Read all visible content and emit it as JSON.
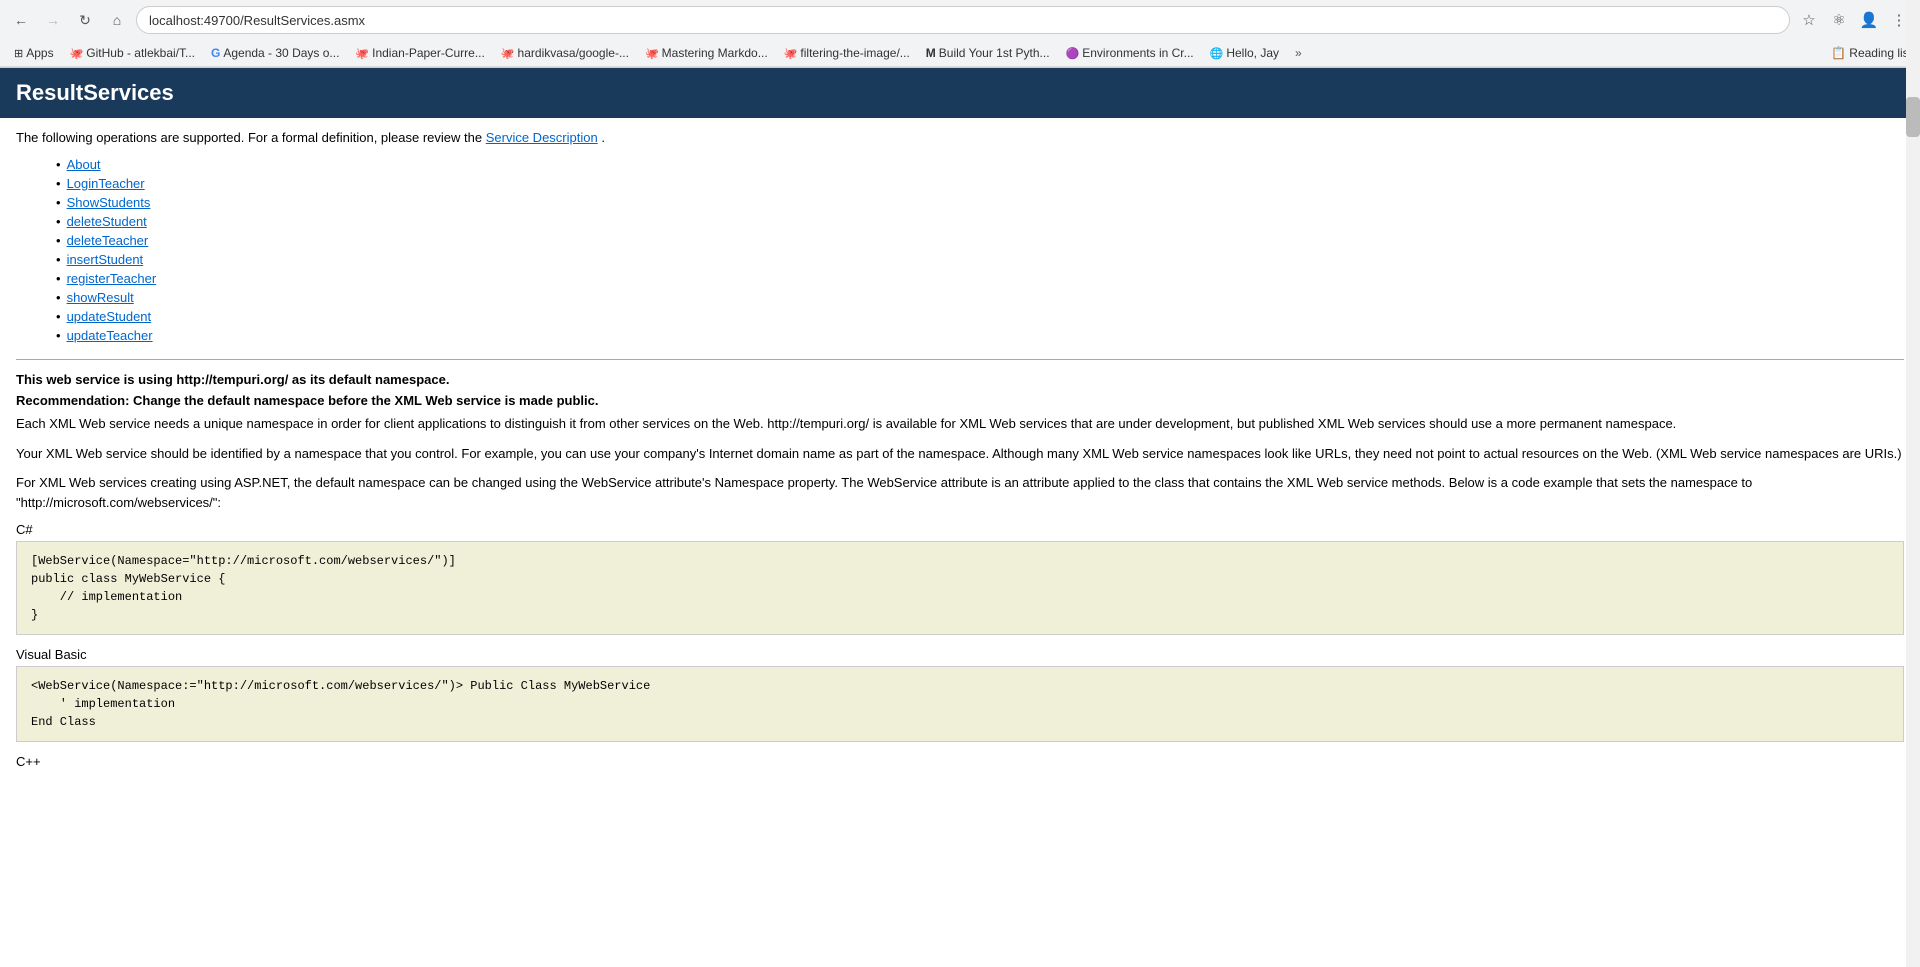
{
  "browser": {
    "url": "localhost:49700/ResultServices.asmx",
    "back_disabled": false,
    "forward_disabled": true,
    "bookmarks": [
      {
        "id": "apps",
        "label": "Apps",
        "icon": "⊞"
      },
      {
        "id": "github-atlekbai",
        "label": "GitHub - atlekbai/T...",
        "icon": "🐙"
      },
      {
        "id": "agenda-30days",
        "label": "Agenda - 30 Days o...",
        "icon": "G"
      },
      {
        "id": "indian-paper",
        "label": "Indian-Paper-Curre...",
        "icon": "🐙"
      },
      {
        "id": "hardikvasa-google",
        "label": "hardikvasa/google-...",
        "icon": "🐙"
      },
      {
        "id": "mastering-markdown",
        "label": "Mastering Markdo...",
        "icon": "🐙"
      },
      {
        "id": "filtering-image",
        "label": "filtering-the-image/...",
        "icon": "🐙"
      },
      {
        "id": "build-python",
        "label": "Build Your 1st Pyth...",
        "icon": "M"
      },
      {
        "id": "environments",
        "label": "Environments in Cr...",
        "icon": "🟣"
      },
      {
        "id": "hello-jay",
        "label": "Hello, Jay",
        "icon": "🌐"
      }
    ],
    "more_label": "»",
    "reading_list_label": "Reading list"
  },
  "page": {
    "title": "ResultServices",
    "intro": "The following operations are supported. For a formal definition, please review the",
    "service_desc_link": "Service Description",
    "intro_end": ".",
    "operations": [
      "About",
      "LoginTeacher",
      "ShowStudents",
      "deleteStudent",
      "deleteTeacher",
      "insertStudent",
      "registerTeacher",
      "showResult",
      "updateStudent",
      "updateTeacher"
    ],
    "namespace_heading1": "This web service is using http://tempuri.org/ as its default namespace.",
    "namespace_heading2": "Recommendation: Change the default namespace before the XML Web service is made public.",
    "para1": "Each XML Web service needs a unique namespace in order for client applications to distinguish it from other services on the Web. http://tempuri.org/ is available for XML Web services that are under development, but published XML Web services should use a more permanent namespace.",
    "para2": "Your XML Web service should be identified by a namespace that you control. For example, you can use your company's Internet domain name as part of the namespace. Although many XML Web service namespaces look like URLs, they need not point to actual resources on the Web. (XML Web service namespaces are URIs.)",
    "para3": "For XML Web services creating using ASP.NET, the default namespace can be changed using the WebService attribute's Namespace property. The WebService attribute is an attribute applied to the class that contains the XML Web service methods. Below is a code example that sets the namespace to \"http://microsoft.com/webservices/\":",
    "code_label_csharp": "C#",
    "code_csharp": "[WebService(Namespace=\"http://microsoft.com/webservices/\")]\npublic class MyWebService {\n    // implementation\n}",
    "code_label_vb": "Visual Basic",
    "code_vb": "<WebService(Namespace:=\"http://microsoft.com/webservices/\")> Public Class MyWebService\n    ' implementation\nEnd Class",
    "code_label_cpp": "C++"
  }
}
